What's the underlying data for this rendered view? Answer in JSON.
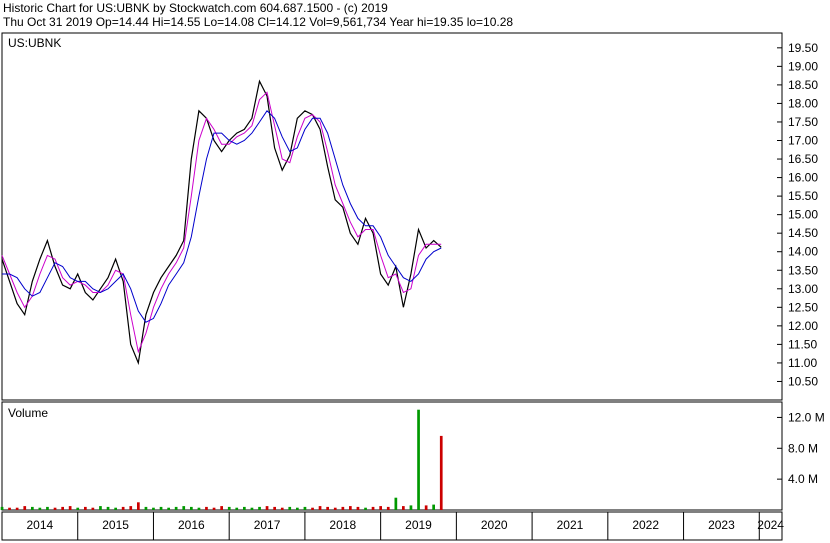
{
  "header": {
    "line1": "Historic Chart for US:UBNK by Stockwatch.com 604.687.1500 - (c) 2019",
    "line2": "Thu Oct 31 2019   Op=14.44  Hi=14.55  Lo=14.08  Cl=14.12  Vol=9,561,734  Year hi=19.35  lo=10.28"
  },
  "chart_data": {
    "type": "line",
    "price_panel": {
      "label": "US:UBNK",
      "ylim": [
        10.0,
        19.9
      ],
      "yticks": [
        "10.50",
        "11.00",
        "11.50",
        "12.00",
        "12.50",
        "13.00",
        "13.50",
        "14.00",
        "14.50",
        "15.00",
        "15.50",
        "16.00",
        "16.50",
        "17.00",
        "17.50",
        "18.00",
        "18.50",
        "19.00",
        "19.50"
      ],
      "price_color": "#000000",
      "ma_short_color": "#cc00cc",
      "ma_long_color": "#0000cc",
      "x": [
        2014.0,
        2014.1,
        2014.2,
        2014.3,
        2014.4,
        2014.5,
        2014.6,
        2014.7,
        2014.8,
        2014.9,
        2015.0,
        2015.1,
        2015.2,
        2015.3,
        2015.4,
        2015.5,
        2015.6,
        2015.7,
        2015.8,
        2015.9,
        2016.0,
        2016.1,
        2016.2,
        2016.3,
        2016.4,
        2016.5,
        2016.6,
        2016.7,
        2016.8,
        2016.9,
        2017.0,
        2017.1,
        2017.2,
        2017.3,
        2017.4,
        2017.5,
        2017.6,
        2017.7,
        2017.8,
        2017.9,
        2018.0,
        2018.1,
        2018.2,
        2018.3,
        2018.4,
        2018.5,
        2018.6,
        2018.7,
        2018.8,
        2018.9,
        2019.0,
        2019.1,
        2019.2,
        2019.3,
        2019.4,
        2019.5,
        2019.6,
        2019.7,
        2019.8
      ],
      "close": [
        13.8,
        13.2,
        12.6,
        12.3,
        13.2,
        13.8,
        14.3,
        13.6,
        13.1,
        13.0,
        13.4,
        12.9,
        12.7,
        13.0,
        13.3,
        13.8,
        13.2,
        11.5,
        11.0,
        12.3,
        12.9,
        13.3,
        13.6,
        13.9,
        14.3,
        16.5,
        17.8,
        17.6,
        17.0,
        16.7,
        17.0,
        17.2,
        17.3,
        17.6,
        18.6,
        18.2,
        16.8,
        16.2,
        16.6,
        17.6,
        17.8,
        17.7,
        17.3,
        16.3,
        15.4,
        15.2,
        14.5,
        14.2,
        14.9,
        14.5,
        13.4,
        13.1,
        13.6,
        12.5,
        13.4,
        14.6,
        14.1,
        14.3,
        14.12
      ],
      "ma_short": [
        13.9,
        13.4,
        12.9,
        12.5,
        12.8,
        13.4,
        13.9,
        13.8,
        13.3,
        13.1,
        13.2,
        13.1,
        12.9,
        12.9,
        13.1,
        13.5,
        13.4,
        12.3,
        11.3,
        11.8,
        12.5,
        13.0,
        13.4,
        13.7,
        14.1,
        15.5,
        17.0,
        17.6,
        17.3,
        16.9,
        16.9,
        17.1,
        17.2,
        17.4,
        18.1,
        18.3,
        17.4,
        16.5,
        16.4,
        17.1,
        17.6,
        17.7,
        17.5,
        16.7,
        15.8,
        15.3,
        14.8,
        14.4,
        14.6,
        14.6,
        13.9,
        13.3,
        13.4,
        12.9,
        13.0,
        13.9,
        14.2,
        14.2,
        14.2
      ],
      "ma_long": [
        13.4,
        13.4,
        13.3,
        13.0,
        12.8,
        12.9,
        13.3,
        13.7,
        13.6,
        13.3,
        13.2,
        13.2,
        13.0,
        12.9,
        13.0,
        13.2,
        13.4,
        13.0,
        12.4,
        12.1,
        12.2,
        12.6,
        13.1,
        13.4,
        13.7,
        14.4,
        15.5,
        16.5,
        17.2,
        17.2,
        17.0,
        16.9,
        17.0,
        17.2,
        17.5,
        17.8,
        17.6,
        17.1,
        16.7,
        16.8,
        17.3,
        17.6,
        17.6,
        17.2,
        16.5,
        15.8,
        15.3,
        14.9,
        14.7,
        14.7,
        14.4,
        13.9,
        13.6,
        13.3,
        13.2,
        13.4,
        13.8,
        14.0,
        14.1
      ]
    },
    "volume_panel": {
      "label": "Volume",
      "ylim": [
        0,
        14.0
      ],
      "yticks": [
        "4.0 M",
        "8.0 M",
        "12.0 M"
      ],
      "unit": "M",
      "x": [
        2014.0,
        2014.1,
        2014.2,
        2014.3,
        2014.4,
        2014.5,
        2014.6,
        2014.7,
        2014.8,
        2014.9,
        2015.0,
        2015.1,
        2015.2,
        2015.3,
        2015.4,
        2015.5,
        2015.6,
        2015.7,
        2015.8,
        2015.9,
        2016.0,
        2016.1,
        2016.2,
        2016.3,
        2016.4,
        2016.5,
        2016.6,
        2016.7,
        2016.8,
        2016.9,
        2017.0,
        2017.1,
        2017.2,
        2017.3,
        2017.4,
        2017.5,
        2017.6,
        2017.7,
        2017.8,
        2017.9,
        2018.0,
        2018.1,
        2018.2,
        2018.3,
        2018.4,
        2018.5,
        2018.6,
        2018.7,
        2018.8,
        2018.9,
        2019.0,
        2019.1,
        2019.2,
        2019.3,
        2019.4,
        2019.5,
        2019.6,
        2019.7,
        2019.8
      ],
      "values": [
        0.4,
        0.3,
        0.3,
        0.5,
        0.4,
        0.3,
        0.4,
        0.3,
        0.4,
        0.5,
        0.3,
        0.4,
        0.3,
        0.5,
        0.4,
        0.3,
        0.4,
        0.5,
        1.0,
        0.4,
        0.3,
        0.4,
        0.3,
        0.4,
        0.5,
        0.4,
        0.3,
        0.4,
        0.3,
        0.5,
        0.4,
        0.3,
        0.4,
        0.3,
        0.4,
        0.5,
        0.4,
        0.3,
        0.4,
        0.3,
        0.4,
        0.3,
        0.5,
        0.4,
        0.3,
        0.4,
        0.5,
        0.4,
        0.3,
        0.4,
        0.5,
        0.4,
        1.6,
        0.5,
        0.6,
        13.0,
        0.6,
        0.7,
        9.6
      ],
      "colors": [
        "#cc0000",
        "#009900"
      ]
    },
    "x_axis": {
      "range": [
        2014.0,
        2024.3
      ],
      "labels": [
        "2014",
        "2015",
        "2016",
        "2017",
        "2018",
        "2019",
        "2020",
        "2021",
        "2022",
        "2023",
        "2024"
      ]
    }
  }
}
